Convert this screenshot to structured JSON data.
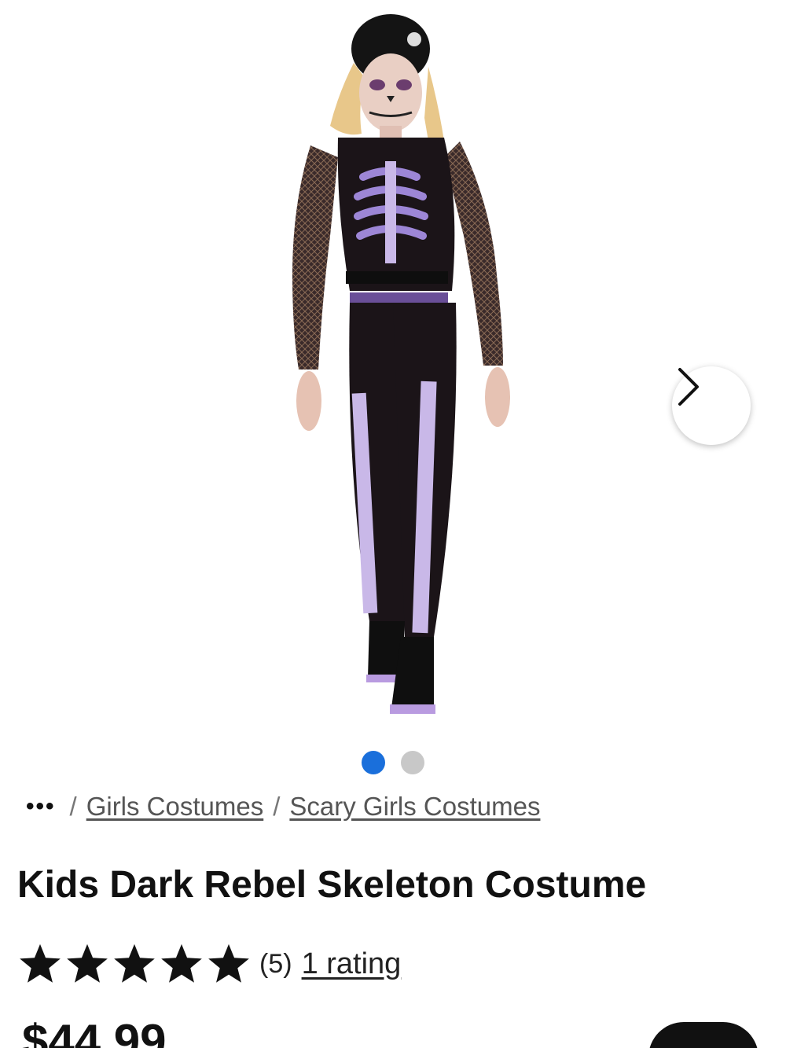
{
  "product": {
    "image_alt": "Kids Dark Rebel Skeleton Costume",
    "title": "Kids Dark Rebel Skeleton Costume",
    "price": "$44.99"
  },
  "carousel": {
    "next_icon": "chevron-right-icon",
    "total_images": 2,
    "active_index": 0
  },
  "breadcrumb": {
    "more_label": "•••",
    "separator": "/",
    "items": [
      {
        "label": "Girls Costumes"
      },
      {
        "label": "Scary Girls Costumes"
      }
    ]
  },
  "rating": {
    "stars": 5,
    "count_label": "(5)",
    "link_label": "1 rating"
  },
  "colors": {
    "accent": "#1a6fdb",
    "dot_inactive": "#c8c8c8",
    "text": "#111111"
  }
}
